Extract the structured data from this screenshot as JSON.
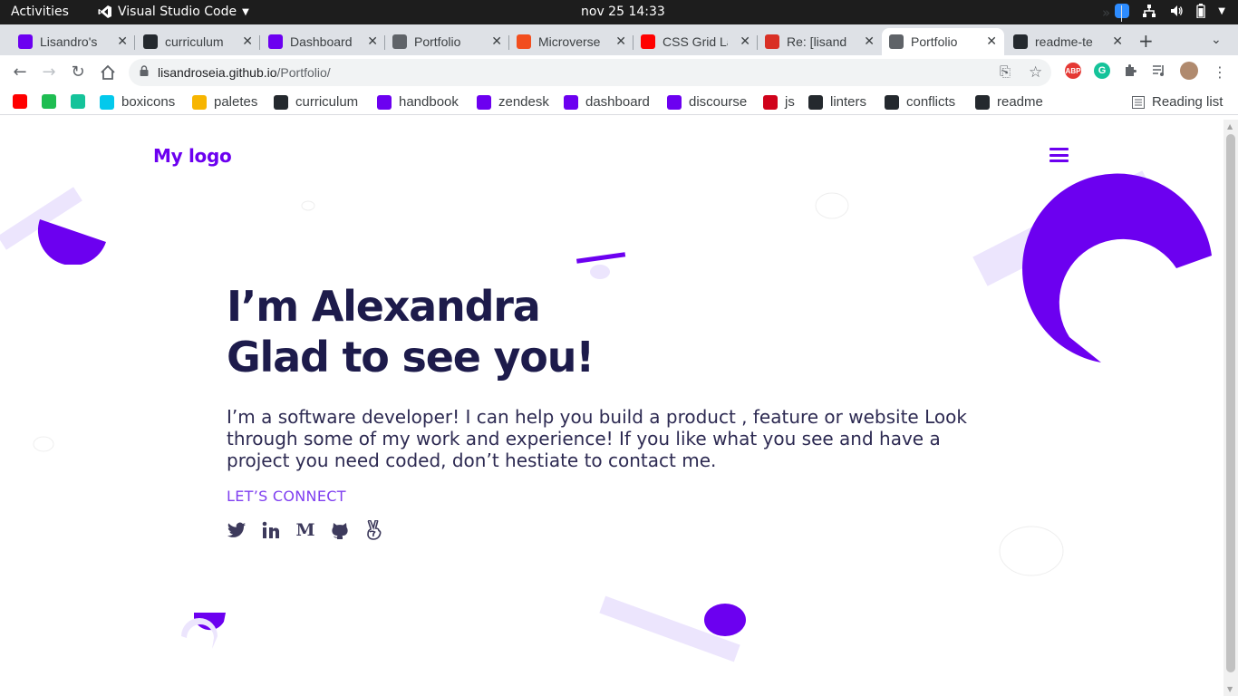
{
  "desktop": {
    "activities": "Activities",
    "app_name": "Visual Studio Code",
    "clock": "nov 25  14:33"
  },
  "tabs": [
    {
      "label": "Lisandro's",
      "icon": "microverse-icon",
      "color": "#6c00f0",
      "active": false
    },
    {
      "label": "curriculum",
      "icon": "github-icon",
      "color": "#24292e",
      "active": false
    },
    {
      "label": "Dashboard",
      "icon": "microverse-icon",
      "color": "#6c00f0",
      "active": false
    },
    {
      "label": "Portfolio",
      "icon": "globe-icon",
      "color": "#5f6368",
      "active": false
    },
    {
      "label": "Microverse",
      "icon": "figma-icon",
      "color": "#f24e1e",
      "active": false
    },
    {
      "label": "CSS Grid La",
      "icon": "youtube-icon",
      "color": "#ff0000",
      "active": false
    },
    {
      "label": "Re: [lisand",
      "icon": "gmail-icon",
      "color": "#d93025",
      "active": false
    },
    {
      "label": "Portfolio",
      "icon": "globe-icon",
      "color": "#5f6368",
      "active": true
    },
    {
      "label": "readme-te",
      "icon": "github-icon",
      "color": "#24292e",
      "active": false
    }
  ],
  "omnibox": {
    "host": "lisandroseia.github.io",
    "path": "/Portfolio/"
  },
  "bookmarks": [
    {
      "label": "",
      "icon": "youtube-icon",
      "color": "#ff0000"
    },
    {
      "label": "",
      "icon": "counter-icon",
      "color": "#1fbd52"
    },
    {
      "label": "",
      "icon": "grammarly-icon",
      "color": "#15c39a"
    },
    {
      "label": "boxicons",
      "icon": "boxicons-icon",
      "color": "#03c9ec"
    },
    {
      "label": "paletes",
      "icon": "palette-icon",
      "color": "#f7b500"
    },
    {
      "label": "curriculum",
      "icon": "github-icon",
      "color": "#24292e"
    },
    {
      "label": "handbook",
      "icon": "microverse-icon",
      "color": "#6c00f0"
    },
    {
      "label": "zendesk",
      "icon": "microverse-icon",
      "color": "#6c00f0"
    },
    {
      "label": "dashboard",
      "icon": "microverse-icon",
      "color": "#6c00f0"
    },
    {
      "label": "discourse",
      "icon": "microverse-icon",
      "color": "#6c00f0"
    },
    {
      "label": "js",
      "icon": "js-icon",
      "color": "#d0021b"
    },
    {
      "label": "linters",
      "icon": "github-icon",
      "color": "#24292e"
    },
    {
      "label": "conflicts",
      "icon": "github-icon",
      "color": "#24292e"
    },
    {
      "label": "readme",
      "icon": "github-icon",
      "color": "#24292e"
    }
  ],
  "bookmarks_more": "»",
  "reading_list": "Reading list",
  "page": {
    "logo": "My logo",
    "title_line1": "I’m Alexandra",
    "title_line2": "Glad to see you!",
    "description": "I’m a software developer! I can help you build a product , feature or website Look through some of my work and experience! If you like what you see and have a project you need coded, don’t hestiate to contact me.",
    "connect_label": "LET’S CONNECT",
    "socials": [
      {
        "name": "twitter-icon",
        "glyph": ""
      },
      {
        "name": "linkedin-icon",
        "glyph": ""
      },
      {
        "name": "medium-icon",
        "glyph": "M"
      },
      {
        "name": "github-icon",
        "glyph": ""
      },
      {
        "name": "angellist-icon",
        "glyph": ""
      }
    ],
    "accent_color": "#6c00f0",
    "heading_color": "#1d1b4b"
  }
}
